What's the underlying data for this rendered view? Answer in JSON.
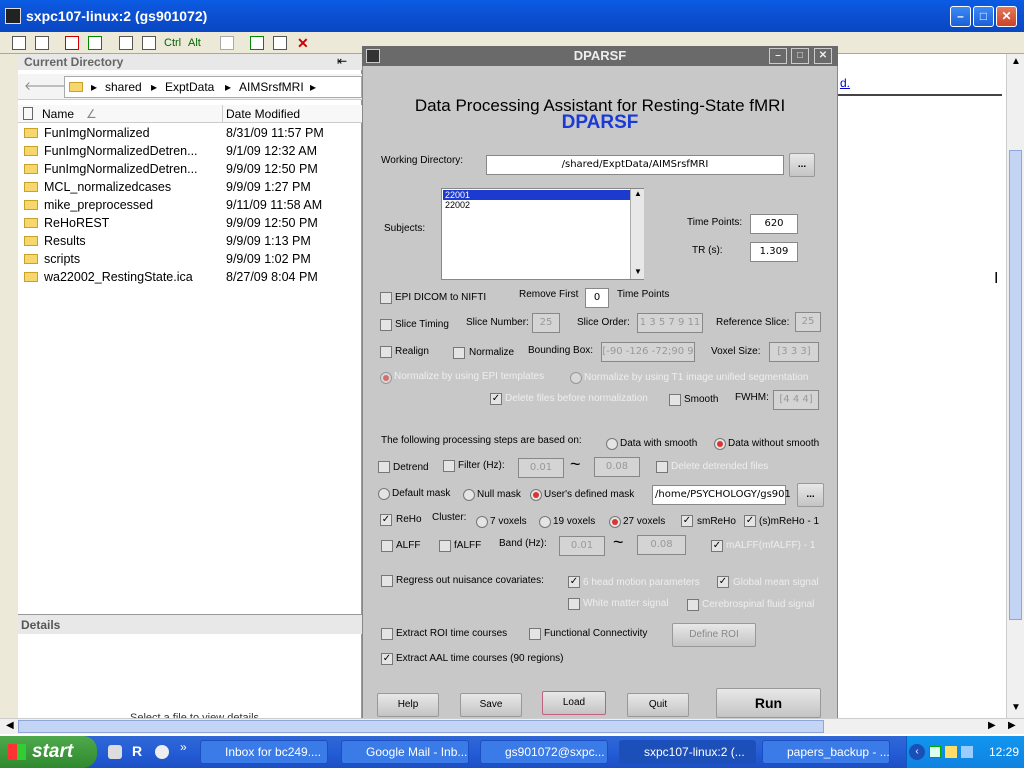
{
  "window": {
    "title": "sxpc107-linux:2 (gs901072)",
    "min": "–",
    "max": "□",
    "close": "✕"
  },
  "toolbar": {
    "ctrl": "Ctrl",
    "alt": "Alt"
  },
  "currentDir": {
    "header": "Current Directory",
    "path": [
      "shared",
      "ExptData",
      "AIMSrsfMRI"
    ],
    "columns": {
      "name": "Name",
      "date": "Date Modified"
    },
    "files": [
      {
        "name": "FunImgNormalized",
        "date": "8/31/09 11:57 PM"
      },
      {
        "name": "FunImgNormalizedDetren...",
        "date": "9/1/09 12:32 AM"
      },
      {
        "name": "FunImgNormalizedDetren...",
        "date": "9/9/09 12:50 PM"
      },
      {
        "name": "MCL_normalizedcases",
        "date": "9/9/09 1:27 PM"
      },
      {
        "name": "mike_preprocessed",
        "date": "9/11/09 11:58 AM"
      },
      {
        "name": "ReHoREST",
        "date": "9/9/09 12:50 PM"
      },
      {
        "name": "Results",
        "date": "9/9/09 1:13 PM"
      },
      {
        "name": "scripts",
        "date": "9/9/09 1:02 PM"
      },
      {
        "name": "wa22002_RestingState.ica",
        "date": "8/27/09 8:04 PM"
      }
    ],
    "details": "Details",
    "detailsHint": "Select a file to view details"
  },
  "rightpane": {
    "linkText": "d."
  },
  "dialog": {
    "title": "DPARSF",
    "heading": "Data Processing Assistant for Resting-State fMRI",
    "subheading": "DPARSF",
    "workingDirLabel": "Working Directory:",
    "workingDir": "/shared/ExptData/AIMSrsfMRI",
    "browse": "...",
    "subjectsLabel": "Subjects:",
    "subjects": [
      "22001",
      "22002"
    ],
    "timePointsLabel": "Time Points:",
    "timePoints": "620",
    "trLabel": "TR (s):",
    "tr": "1.309",
    "epiDicom": "EPI DICOM to NIFTI",
    "removeFirst": "Remove First",
    "removeFirstValue": "0",
    "timePointsSuffix": "Time Points",
    "sliceTiming": "Slice Timing",
    "sliceNumber": "Slice Number:",
    "sliceNumberValue": "25",
    "sliceOrder": "Slice Order:",
    "sliceOrderValue": "1 3 5 7 9 11",
    "refSlice": "Reference Slice:",
    "refSliceValue": "25",
    "realign": "Realign",
    "normalize": "Normalize",
    "boundingBox": "Bounding Box:",
    "boundingBoxValue": "[-90 -126 -72;90 9",
    "voxelSize": "Voxel Size:",
    "voxelSizeValue": "[3 3 3]",
    "normEpi": "Normalize by using EPI templates",
    "normT1": "Normalize by using T1 image unified segmentation",
    "deleteFiles": "Delete files before normalization",
    "smooth": "Smooth",
    "fwhm": "FWHM:",
    "fwhmValue": "[4 4 4]",
    "basedOn": "The following processing steps are based on:",
    "withSmooth": "Data with smooth",
    "withoutSmooth": "Data without smooth",
    "detrend": "Detrend",
    "filter": "Filter (Hz):",
    "filterLow": "0.01",
    "filterHigh": "0.08",
    "deleteDetrended": "Delete detrended files",
    "defaultMask": "Default mask",
    "nullMask": "Null mask",
    "userMask": "User's defined mask",
    "maskPath": "/home/PSYCHOLOGY/gs901",
    "reho": "ReHo",
    "cluster": "Cluster:",
    "c7": "7 voxels",
    "c19": "19 voxels",
    "c27": "27 voxels",
    "smReho": "smReHo",
    "smRehoMinus": "(s)mReHo - 1",
    "alff": "ALFF",
    "falff": "fALFF",
    "band": "Band (Hz):",
    "bandLow": "0.01",
    "bandHigh": "0.08",
    "malff": "mALFF(mfALFF) - 1",
    "regressOut": "Regress out nuisance covariates:",
    "headMotion": "6 head motion parameters",
    "globalMean": "Global mean signal",
    "whiteMatter": "White matter signal",
    "csf": "Cerebrospinal fluid signal",
    "extractRoi": "Extract ROI time courses",
    "funcConn": "Functional Connectivity",
    "defineRoi": "Define ROI",
    "extractAal": "Extract AAL time courses (90 regions)",
    "help": "Help",
    "save": "Save",
    "load": "Load",
    "quit": "Quit",
    "run": "Run"
  },
  "taskbar": {
    "start": "start",
    "tasks": [
      "Inbox for bc249....",
      "Google Mail - Inb...",
      "gs901072@sxpc...",
      "sxpc107-linux:2 (...",
      "papers_backup - ..."
    ],
    "clock": "12:29"
  }
}
